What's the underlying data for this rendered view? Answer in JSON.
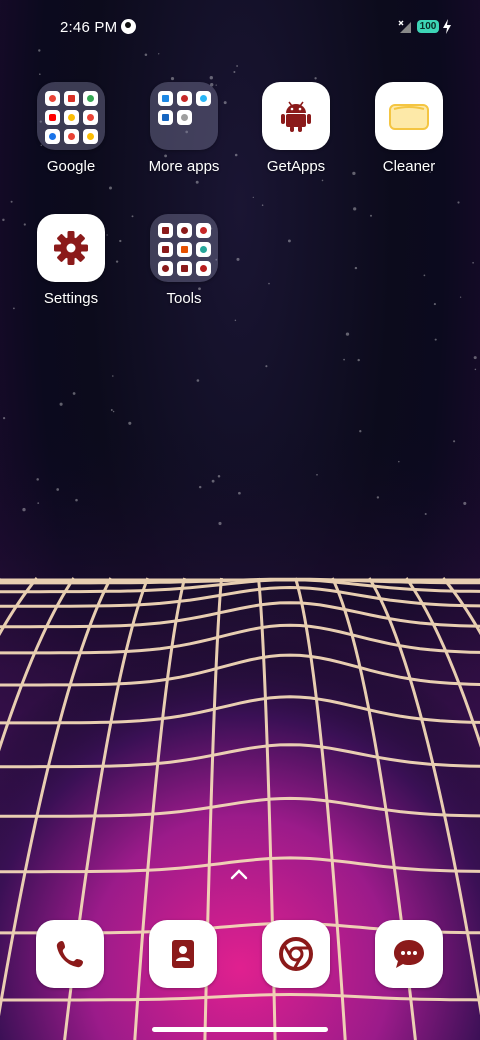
{
  "status_bar": {
    "time": "2:46 PM",
    "battery": "100"
  },
  "apps": [
    {
      "name": "Google",
      "type": "folder"
    },
    {
      "name": "More apps",
      "type": "folder"
    },
    {
      "name": "GetApps",
      "type": "app",
      "icon": "android-icon"
    },
    {
      "name": "Cleaner",
      "type": "app",
      "icon": "cleaner-icon"
    },
    {
      "name": "Settings",
      "type": "app",
      "icon": "gear-icon"
    },
    {
      "name": "Tools",
      "type": "folder"
    }
  ],
  "dock": [
    {
      "icon": "phone-icon"
    },
    {
      "icon": "contacts-icon"
    },
    {
      "icon": "browser-icon"
    },
    {
      "icon": "messages-icon"
    }
  ],
  "colors": {
    "accent": "#7b1414",
    "battery": "#3dd5b6"
  }
}
